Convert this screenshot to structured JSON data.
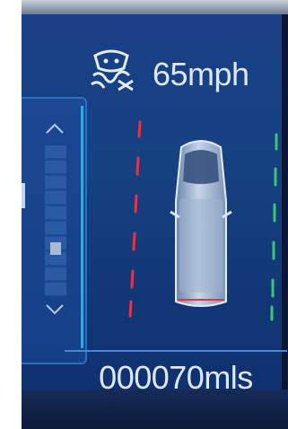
{
  "speed": {
    "value": "65",
    "unit": "mph"
  },
  "odometer": {
    "value": "000070",
    "unit": "mls"
  },
  "icons": {
    "status": "traction-control-off-icon",
    "vehicle": "van-top-view-icon",
    "scroll_up": "chevron-up-icon",
    "scroll_down": "chevron-down-icon"
  },
  "lanes": {
    "left_color": "#e0354b",
    "right_color": "#3ec66f"
  },
  "scroll": {
    "position": 0.7
  }
}
